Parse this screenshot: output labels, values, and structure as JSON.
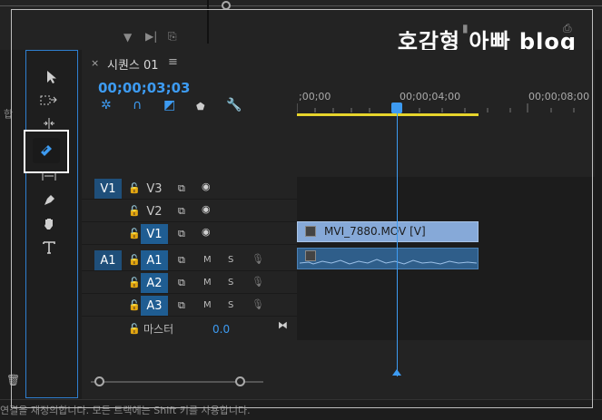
{
  "watermark": "호감형 아빠 blog",
  "left_edge_text": "합",
  "sequence_tab": {
    "close": "×",
    "label": "시퀀스 01",
    "menu": "≡"
  },
  "timecode": "00;00;03;03",
  "ruler": {
    "ticks": [
      ";00;00",
      "00;00;04;00",
      "00;00;08;00"
    ]
  },
  "playhead_position": "00;00;03;03",
  "tracks": {
    "video": [
      {
        "name": "V3",
        "source": "",
        "targeted": false
      },
      {
        "name": "V2",
        "source": "",
        "targeted": false
      },
      {
        "name": "V1",
        "source": "V1",
        "targeted": true
      }
    ],
    "audio": [
      {
        "name": "A1",
        "source": "A1",
        "targeted": true,
        "m": "M",
        "s": "S"
      },
      {
        "name": "A2",
        "source": "",
        "targeted": true,
        "m": "M",
        "s": "S"
      },
      {
        "name": "A3",
        "source": "",
        "targeted": true,
        "m": "M",
        "s": "S"
      }
    ],
    "source_v1": "V1",
    "source_a1": "A1"
  },
  "master": {
    "label": "마스터",
    "value": "0.0"
  },
  "clips": {
    "video_clip": "MVI_7880.MOV [V]"
  },
  "tools": [
    "selection-tool",
    "track-select-tool",
    "ripple-edit-tool",
    "razor-tool",
    "slip-tool",
    "pen-tool",
    "hand-tool",
    "type-tool"
  ],
  "status_text": "연결을 재정의합니다. 모든 트랙에는 Shift 키를 사용합니다.",
  "colors": {
    "accent": "#3d9bf2",
    "work_area": "#e6d42c",
    "video_clip": "#86a9d8",
    "audio_clip": "#2f5e8a"
  }
}
